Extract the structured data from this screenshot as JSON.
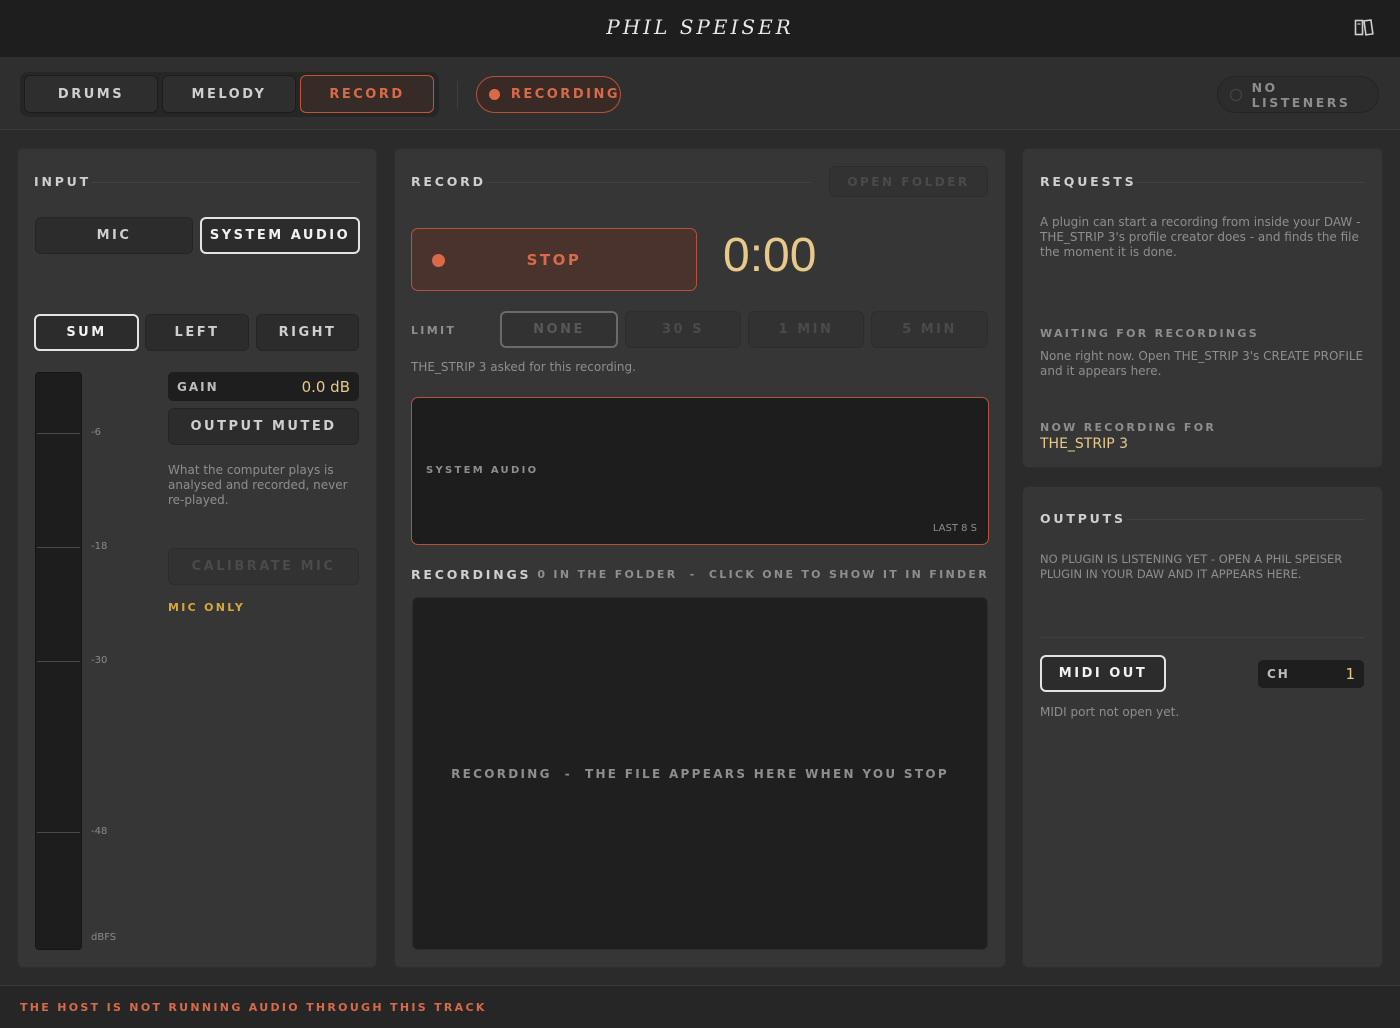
{
  "app": {
    "title": "PHIL SPEISER"
  },
  "icons": {
    "help": "book-icon",
    "record_dot": "record-dot-icon",
    "listener_dot": "status-dot-icon"
  },
  "colors": {
    "accent": "#d86a4a",
    "value": "#e8c98a",
    "background": "#2b2b2b"
  },
  "tabs": [
    {
      "label": "DRUMS"
    },
    {
      "label": "MELODY"
    },
    {
      "label": "RECORD",
      "active": true
    }
  ],
  "status": {
    "recording": "RECORDING",
    "listeners": "NO LISTENERS"
  },
  "input": {
    "title": "INPUT",
    "sources": [
      "MIC",
      "SYSTEM AUDIO"
    ],
    "selected_source": "SYSTEM AUDIO",
    "channels": [
      "SUM",
      "LEFT",
      "RIGHT"
    ],
    "selected_channel": "SUM",
    "gain_label": "GAIN",
    "gain_value": "0.0 dB",
    "output_muted": "OUTPUT MUTED",
    "description": "What the computer plays is analysed and recorded, never re-played.",
    "calibrate": "CALIBRATE MIC",
    "mic_only": "MIC ONLY",
    "meter_labels": [
      "-6",
      "-18",
      "-30",
      "-48",
      "dBFS"
    ]
  },
  "record": {
    "title": "RECORD",
    "open_folder": "OPEN FOLDER",
    "stop": "STOP",
    "timer": "0:00",
    "limit_label": "LIMIT",
    "limits": [
      "NONE",
      "30 S",
      "1 MIN",
      "5 MIN"
    ],
    "selected_limit": "NONE",
    "asked_by": "THE_STRIP 3 asked for this recording.",
    "wave_label": "SYSTEM AUDIO",
    "wave_window": "LAST 8 S"
  },
  "recordings": {
    "title": "RECORDINGS",
    "summary": "0 IN THE FOLDER  -  CLICK ONE TO SHOW IT IN FINDER",
    "empty": "RECORDING  -  THE FILE APPEARS HERE WHEN YOU STOP"
  },
  "requests": {
    "title": "REQUESTS",
    "intro": "A plugin can start a recording from inside your DAW - THE_STRIP 3's profile creator does - and finds the file the moment it is done.",
    "waiting_title": "WAITING FOR RECORDINGS",
    "waiting_text": "None right now. Open THE_STRIP 3's CREATE PROFILE and it appears here.",
    "now_title": "NOW RECORDING FOR",
    "now_value": "THE_STRIP 3"
  },
  "outputs": {
    "title": "OUTPUTS",
    "note": "NO PLUGIN IS LISTENING YET  -  OPEN A PHIL SPEISER PLUGIN IN YOUR DAW AND IT APPEARS HERE.",
    "midi_out": "MIDI OUT",
    "ch_label": "CH",
    "ch_value": "1",
    "midi_status": "MIDI port not open yet."
  },
  "footer": {
    "message": "THE HOST IS NOT RUNNING AUDIO THROUGH THIS TRACK"
  }
}
